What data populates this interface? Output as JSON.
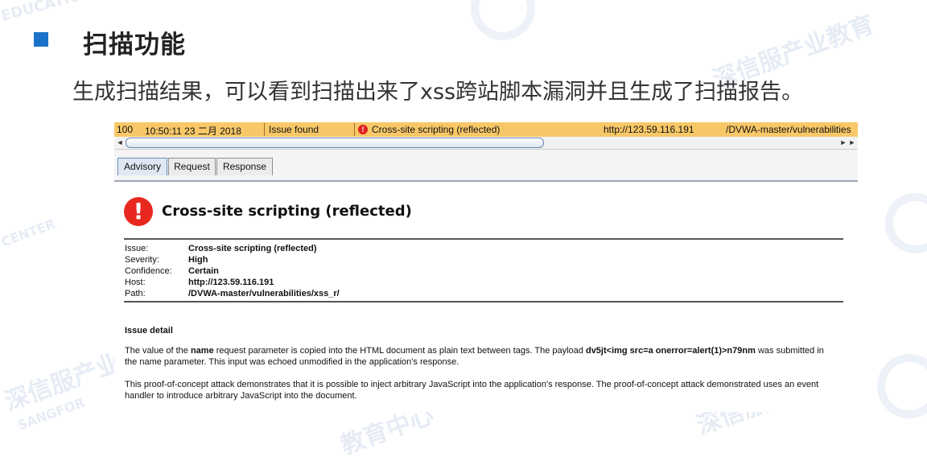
{
  "slide": {
    "title": "扫描功能",
    "subtitle": "生成扫描结果，可以看到扫描出来了xss跨站脚本漏洞并且生成了扫描报告。"
  },
  "watermark": {
    "brand_cn": "深信服产业教育",
    "center_cn": "教育中心",
    "education_en": "EDUCATION",
    "sangfor_en": "SANGFOR",
    "center_en": "CENTER"
  },
  "issue_row": {
    "id": "100",
    "time": "10:50:11 23 二月 2018",
    "tool": "Issue found",
    "issue": "Cross-site scripting (reflected)",
    "host": "http://123.59.116.191",
    "path": "/DVWA-master/vulnerabilities"
  },
  "scroll": {
    "left_arrow": "◄",
    "right_arrow": "►"
  },
  "tabs": [
    {
      "label": "Advisory",
      "active": true
    },
    {
      "label": "Request",
      "active": false
    },
    {
      "label": "Response",
      "active": false
    }
  ],
  "advisory": {
    "icon_glyph": "!",
    "title": "Cross-site scripting (reflected)",
    "fields": [
      {
        "key": "Issue:",
        "value": "Cross-site scripting (reflected)"
      },
      {
        "key": "Severity:",
        "value": "High"
      },
      {
        "key": "Confidence:",
        "value": "Certain"
      },
      {
        "key": "Host:",
        "value": "http://123.59.116.191"
      },
      {
        "key": "Path:",
        "value": "/DVWA-master/vulnerabilities/xss_r/"
      }
    ],
    "detail_heading": "Issue detail",
    "p1": {
      "a": "The value of the ",
      "b": "name",
      "c": " request parameter is copied into the HTML document as plain text between tags. The payload ",
      "d": "dv5jt<img src=a onerror=alert(1)>n79nm",
      "e": " was submitted in the name parameter. This input was echoed unmodified in the application's response."
    },
    "p2": "This proof-of-concept attack demonstrates that it is possible to inject arbitrary JavaScript into the application's response. The proof-of-concept attack demonstrated uses an event handler to introduce arbitrary JavaScript into the document."
  },
  "colors": {
    "accent": "#1a73c9",
    "issue_row_bg": "#f8c868",
    "alert_red": "#e8281e"
  }
}
